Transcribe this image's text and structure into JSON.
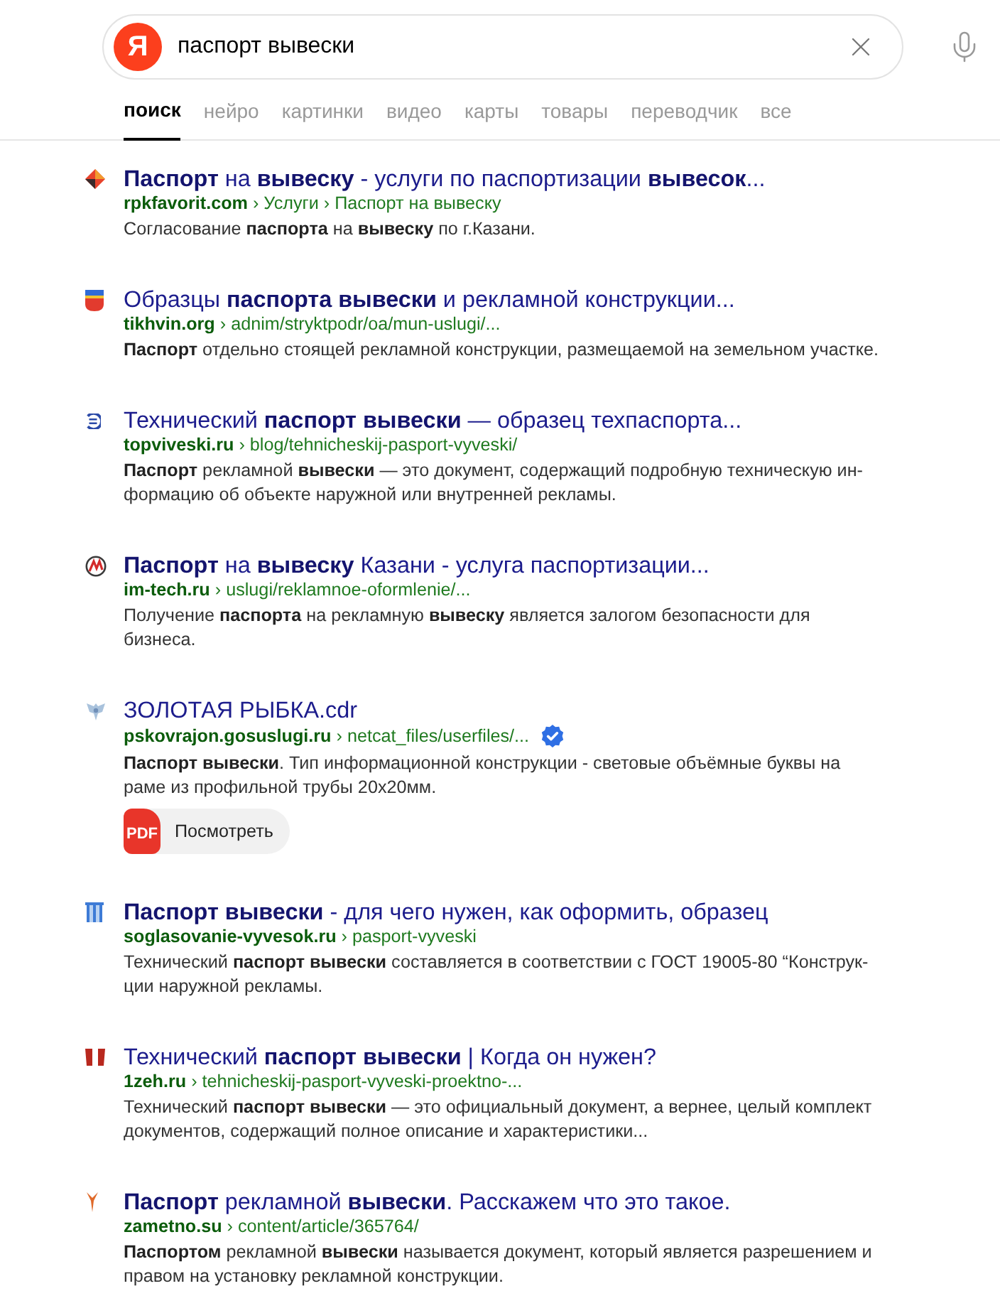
{
  "search": {
    "logo": "Я",
    "query": "паспорт вывески"
  },
  "tabs": [
    {
      "label": "поиск",
      "selected": true
    },
    {
      "label": "нейро",
      "selected": false
    },
    {
      "label": "картинки",
      "selected": false
    },
    {
      "label": "видео",
      "selected": false
    },
    {
      "label": "карты",
      "selected": false
    },
    {
      "label": "товары",
      "selected": false
    },
    {
      "label": "переводчик",
      "selected": false
    },
    {
      "label": "все",
      "selected": false
    }
  ],
  "results": [
    {
      "title": "**Паспорт** на **вывеску** - услуги по паспортизации **вывесок**...",
      "url": "**rpkfavorit.com** › Услуги › Паспорт на вывеску",
      "verified": false,
      "snippet": "Согласование **паспорта** на **вывеску** по г.Казани."
    },
    {
      "title": "Образцы **паспорта вывески** и рекламной конструкции...",
      "url": "**tikhvin.org** › adnim/stryktpodr/oa/mun-uslugi/...",
      "verified": false,
      "snippet": "**Паспорт** отдельно стоящей рекламной конструкции, размещаемой на земельном участке."
    },
    {
      "title": "Технический **паспорт вывески** — образец техпаспорта...",
      "url": "**topviveski.ru** › blog/tehnicheskij-pasport-vyveski/",
      "verified": false,
      "snippet": "**Паспорт** рекламной **вывески** — это документ, содержащий подробную техническую ин-формацию об объекте наружной или внутренней рекламы."
    },
    {
      "title": "**Паспорт** на **вывеску** Казани - услуга паспортизации...",
      "url": "**im-tech.ru** › uslugi/reklamnoe-oformlenie/...",
      "verified": false,
      "snippet": "Получение **паспорта** на рекламную **вывеску** является залогом безопасности для бизнеса."
    },
    {
      "title": "ЗОЛОТАЯ РЫБКА.cdr",
      "url": "**pskovrajon.gosuslugi.ru** › netcat_files/userfiles/...",
      "verified": true,
      "snippet": "**Паспорт вывески**. Тип информационной конструкции - световые объёмные буквы на раме из профильной трубы 20х20мм.",
      "attachment": {
        "kind": "pdf",
        "badge": "PDF",
        "label": "Посмотреть"
      }
    },
    {
      "title": "**Паспорт вывески** - для чего нужен, как оформить, образец",
      "url": "**soglasovanie-vyvesok.ru** › pasport-vyveski",
      "verified": false,
      "snippet": "Технический **паспорт вывески** составляется в соответствии с ГОСТ 19005-80 “Конструк-ции наружной рекламы."
    },
    {
      "title": "Технический **паспорт вывески** | Когда он нужен?",
      "url": "**1zeh.ru** › tehnicheskij-pasport-vyveski-proektno-...",
      "verified": false,
      "snippet": "Технический **паспорт вывески** — это официальный документ, а вернее, целый комплект документов, содержащий полное описание и характеристики..."
    },
    {
      "title": "**Паспорт** рекламной **вывески**. Расскажем что это такое.",
      "url": "**zametno.su** › content/article/365764/",
      "verified": false,
      "snippet": "**Паспортом** рекламной **вывески** называется документ, который является разрешением и правом на установку рекламной конструкции."
    }
  ]
}
